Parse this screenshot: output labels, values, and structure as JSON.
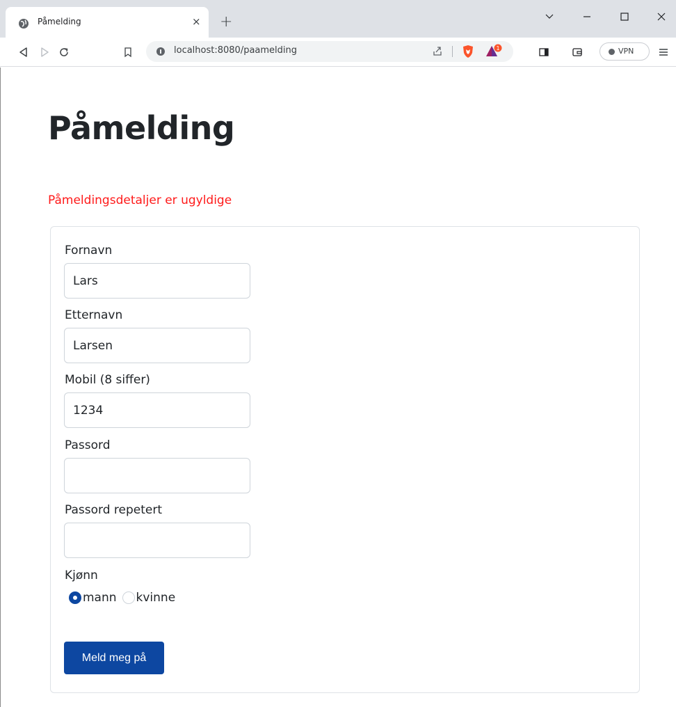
{
  "browser": {
    "tab_title": "Påmelding",
    "tab_close": "×",
    "new_tab": "+",
    "url": "localhost:8080/paamelding",
    "vpn_label": "VPN",
    "bat_badge_count": "1",
    "icons": [
      "globe-icon",
      "close-icon",
      "plus-icon",
      "chevron-down-icon",
      "minimize-icon",
      "maximize-icon",
      "window-close-icon",
      "back-icon",
      "forward-icon",
      "reload-icon",
      "bookmark-icon",
      "info-icon",
      "share-icon",
      "brave-shields-icon",
      "brave-rewards-icon",
      "sidebar-icon",
      "wallet-icon",
      "menu-icon"
    ]
  },
  "page": {
    "title": "Påmelding",
    "error": "Påmeldingsdetaljer er ugyldige",
    "error_color": "#ff1a1a",
    "form": {
      "fields": [
        {
          "label": "Fornavn",
          "value": "Lars"
        },
        {
          "label": "Etternavn",
          "value": "Larsen"
        },
        {
          "label": "Mobil (8 siffer)",
          "value": "1234"
        },
        {
          "label": "Passord",
          "value": ""
        },
        {
          "label": "Passord repetert",
          "value": ""
        }
      ],
      "gender": {
        "label": "Kjønn",
        "options": [
          "mann",
          "kvinne"
        ],
        "selected": "mann"
      },
      "submit_label": "Meld meg på",
      "accent_color": "#0d47a1"
    }
  }
}
